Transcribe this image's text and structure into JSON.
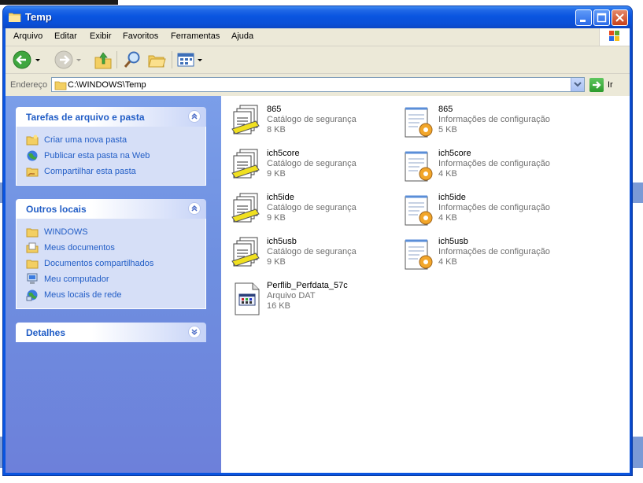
{
  "window": {
    "title": "Temp"
  },
  "menu": [
    "Arquivo",
    "Editar",
    "Exibir",
    "Favoritos",
    "Ferramentas",
    "Ajuda"
  ],
  "address": {
    "label": "Endereço",
    "value": "C:\\WINDOWS\\Temp",
    "go_label": "Ir"
  },
  "panels": {
    "tasks": {
      "title": "Tarefas de arquivo e pasta",
      "items": [
        "Criar uma nova pasta",
        "Publicar esta pasta na Web",
        "Compartilhar esta pasta"
      ]
    },
    "places": {
      "title": "Outros locais",
      "items": [
        "WINDOWS",
        "Meus documentos",
        "Documentos compartilhados",
        "Meu computador",
        "Meus locais de rede"
      ]
    },
    "details": {
      "title": "Detalhes"
    }
  },
  "files": [
    {
      "name": "865",
      "type": "Catálogo de segurança",
      "size": "8 KB",
      "icon": "security-catalog-icon"
    },
    {
      "name": "865",
      "type": "Informações de configuração",
      "size": "5 KB",
      "icon": "setup-info-icon"
    },
    {
      "name": "ich5core",
      "type": "Catálogo de segurança",
      "size": "9 KB",
      "icon": "security-catalog-icon"
    },
    {
      "name": "ich5core",
      "type": "Informações de configuração",
      "size": "4 KB",
      "icon": "setup-info-icon"
    },
    {
      "name": "ich5ide",
      "type": "Catálogo de segurança",
      "size": "9 KB",
      "icon": "security-catalog-icon"
    },
    {
      "name": "ich5ide",
      "type": "Informações de configuração",
      "size": "4 KB",
      "icon": "setup-info-icon"
    },
    {
      "name": "ich5usb",
      "type": "Catálogo de segurança",
      "size": "9 KB",
      "icon": "security-catalog-icon"
    },
    {
      "name": "ich5usb",
      "type": "Informações de configuração",
      "size": "4 KB",
      "icon": "setup-info-icon"
    },
    {
      "name": "Perflib_Perfdata_57c",
      "type": "Arquivo DAT",
      "size": "16 KB",
      "icon": "dat-file-icon"
    }
  ],
  "colors": {
    "titlebar": "#0a55e0",
    "taskpane": "#7b9ee9",
    "panel_title": "#215dc6"
  }
}
